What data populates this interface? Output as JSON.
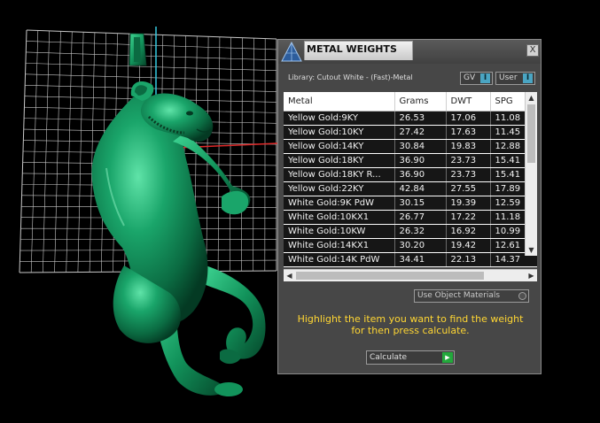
{
  "panel": {
    "title": "METAL WEIGHTS",
    "close_label": "X",
    "library_label": "Library: Cutout White - (Fast)-Metal",
    "gv_label": "GV",
    "user_label": "User",
    "toggle_glyph": "I",
    "use_object_materials": "Use Object Materials",
    "instructions_line1": "Highlight the item you want to find the weight",
    "instructions_line2": "for then press calculate.",
    "calculate_label": "Calculate"
  },
  "table": {
    "headers": [
      "Metal",
      "Grams",
      "DWT",
      "SPG"
    ],
    "rows": [
      [
        "Yellow Gold:9KY",
        "26.53",
        "17.06",
        "11.08"
      ],
      [
        "Yellow Gold:10KY",
        "27.42",
        "17.63",
        "11.45"
      ],
      [
        "Yellow Gold:14KY",
        "30.84",
        "19.83",
        "12.88"
      ],
      [
        "Yellow Gold:18KY",
        "36.90",
        "23.73",
        "15.41"
      ],
      [
        "Yellow Gold:18KY R...",
        "36.90",
        "23.73",
        "15.41"
      ],
      [
        "Yellow Gold:22KY",
        "42.84",
        "27.55",
        "17.89"
      ],
      [
        "White Gold:9K PdW",
        "30.15",
        "19.39",
        "12.59"
      ],
      [
        "White Gold:10KX1",
        "26.77",
        "17.22",
        "11.18"
      ],
      [
        "White Gold:10KW",
        "26.32",
        "16.92",
        "10.99"
      ],
      [
        "White Gold:14KX1",
        "30.20",
        "19.42",
        "12.61"
      ],
      [
        "White Gold:14K PdW",
        "34.41",
        "22.13",
        "14.37"
      ]
    ]
  },
  "colors": {
    "panel_bg": "#474747",
    "instruction_text": "#ffd633",
    "model_green": "#14985f",
    "grid_line": "#c8c8c8",
    "axis_cyan": "#36c9e0",
    "axis_red": "#e02a2a",
    "toggle_accent": "#4aa5c3",
    "calculate_play": "#23a83c"
  },
  "icons": {
    "logo": "pyramid-logo-icon",
    "close": "close-icon",
    "calculate": "play-icon"
  }
}
